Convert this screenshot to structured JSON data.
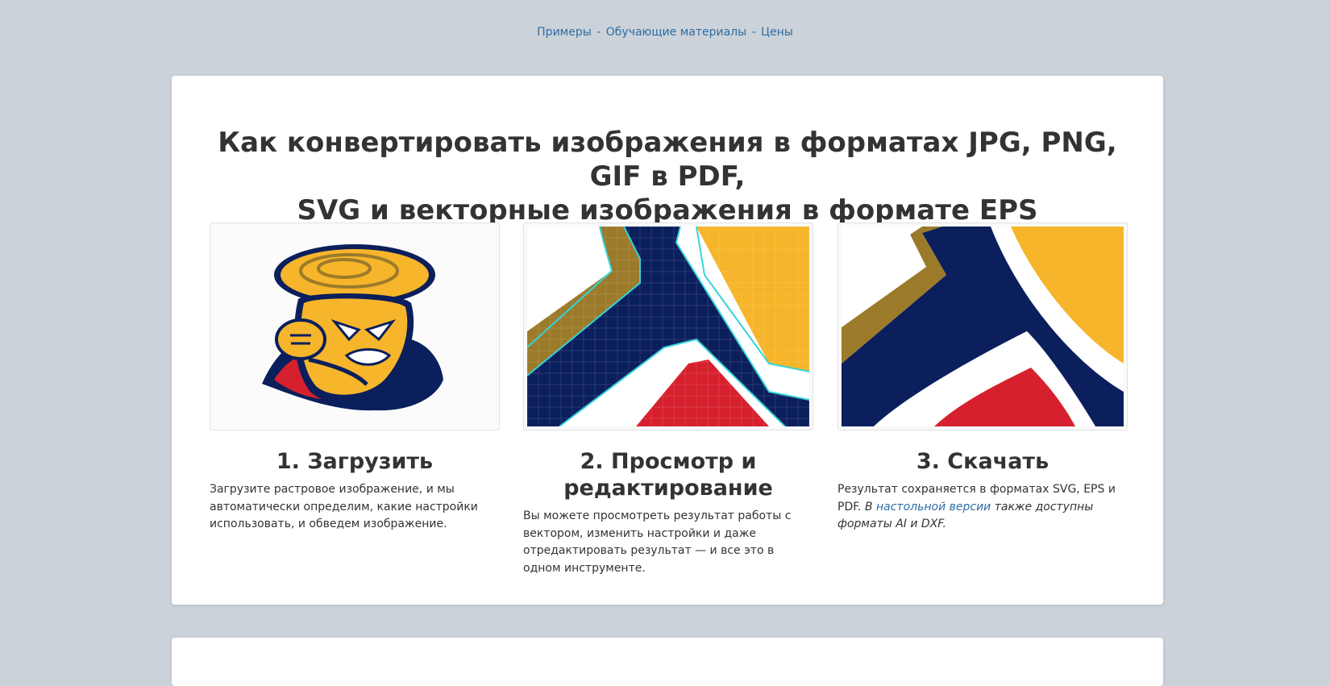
{
  "nav": {
    "items": [
      "Примеры",
      "Обучающие материалы",
      "Цены"
    ],
    "separator": "-"
  },
  "heading": {
    "line1": "Как конвертировать изображения в форматах JPG, PNG, GIF в PDF,",
    "line2": "SVG и векторные изображения в формате EPS"
  },
  "steps": [
    {
      "title": "1. Загрузить",
      "text": "Загрузите растровое изображение, и мы автоматически определим, какие настройки использовать, и обведем изображение.",
      "image_icon": "tornado-mascot-logo"
    },
    {
      "title_line1": "2. Просмотр и",
      "title_line2": "редактирование",
      "text": "Вы можете просмотреть результат работы с вектором, изменить настройки и даже отредактировать результат — и все это в одном инструменте.",
      "image_icon": "pixelated-zoom-with-vector-outline"
    },
    {
      "title": "3. Скачать",
      "text_plain": "Результат сохраняется в форматах SVG, EPS и PDF.",
      "text_italic_before": "В",
      "link": "настольной версии",
      "text_italic_after": "также доступны форматы AI и DXF.",
      "image_icon": "smooth-vector-zoom"
    }
  ],
  "colors": {
    "background": "#cbd2d9",
    "link": "#2e6da4",
    "gold": "#f6b52a",
    "navy": "#0b1f5c",
    "red": "#d7202e",
    "bronze": "#9b7a2a"
  }
}
